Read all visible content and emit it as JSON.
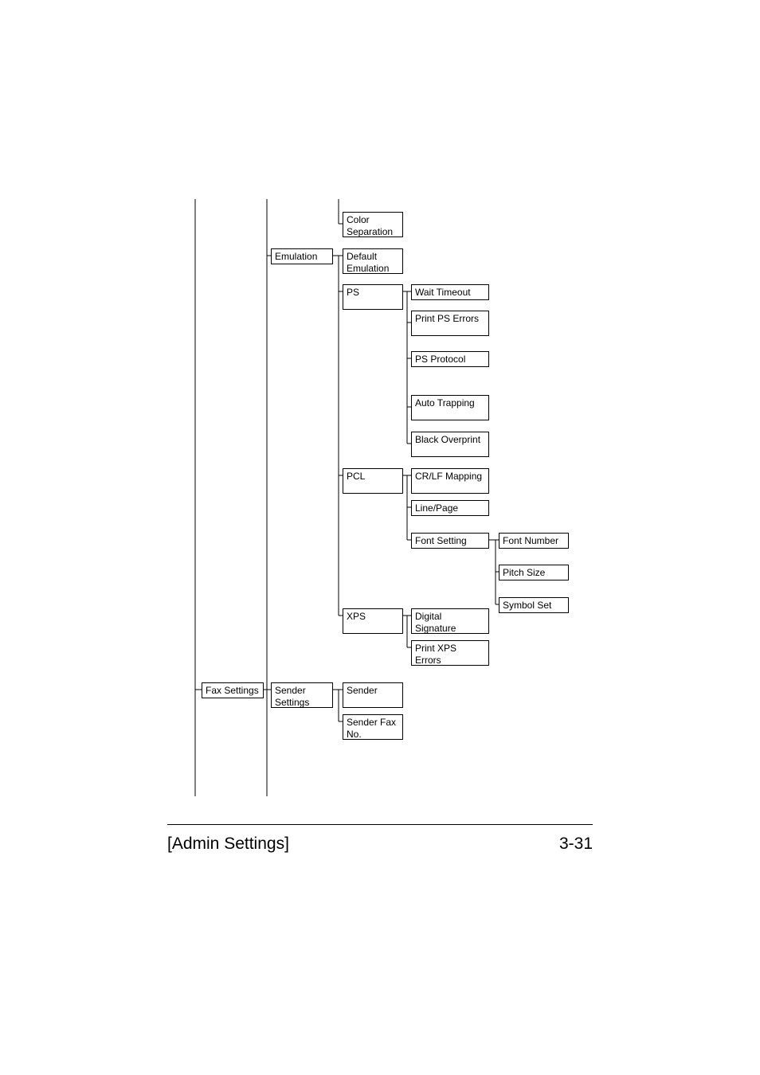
{
  "footer": {
    "left": "[Admin Settings]",
    "right": "3-31"
  },
  "tree": {
    "col2_prev_child": {
      "label": "Color Separation"
    },
    "emulation": {
      "label": "Emulation"
    },
    "emu": {
      "default": {
        "label": "Default Emulation"
      },
      "ps": {
        "label": "PS"
      },
      "pcl": {
        "label": "PCL"
      },
      "xps": {
        "label": "XPS"
      }
    },
    "ps_children": {
      "wait": {
        "label": "Wait Timeout"
      },
      "printps": {
        "label": "Print PS Errors"
      },
      "psproto": {
        "label": "PS Protocol"
      },
      "autotrap": {
        "label": "Auto Trapping"
      },
      "blackop": {
        "label": "Black Overprint"
      }
    },
    "pcl_children": {
      "crlf": {
        "label": "CR/LF Mapping"
      },
      "linep": {
        "label": "Line/Page"
      },
      "fontset": {
        "label": "Font Setting"
      }
    },
    "fontset_children": {
      "fontnum": {
        "label": "Font Number"
      },
      "pitch": {
        "label": "Pitch Size"
      },
      "symset": {
        "label": "Symbol Set"
      }
    },
    "xps_children": {
      "digsig": {
        "label": "Digital Signature"
      },
      "printxps": {
        "label": "Print XPS Errors"
      }
    },
    "fax": {
      "label": "Fax Settings"
    },
    "fax_sender_settings": {
      "label": "Sender Settings"
    },
    "fax_sender_children": {
      "sender": {
        "label": "Sender"
      },
      "senderfax": {
        "label": "Sender Fax No."
      }
    }
  }
}
